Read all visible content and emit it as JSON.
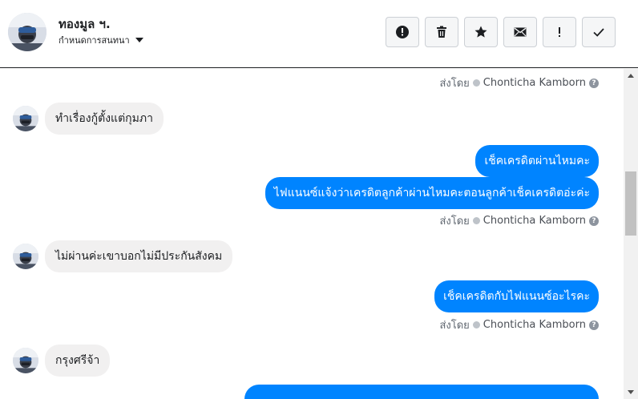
{
  "contact": {
    "name": "ทองมูล ฯ.",
    "subtitle": "กำหนดการสนทนา"
  },
  "toolbar": {
    "buttons": [
      {
        "icon": "alert-circle-icon",
        "name": "mark-spam-button"
      },
      {
        "icon": "trash-icon",
        "name": "delete-button"
      },
      {
        "icon": "star-icon",
        "name": "star-button"
      },
      {
        "icon": "envelope-icon",
        "name": "mark-unread-button"
      },
      {
        "icon": "exclamation-icon",
        "name": "follow-up-button"
      },
      {
        "icon": "check-icon",
        "name": "mark-done-button"
      }
    ]
  },
  "sentby": {
    "prefix": "ส่งโดย",
    "agent": "Chonticha Kamborn",
    "help": "?"
  },
  "messages": [
    {
      "direction": "in",
      "text": "ทำเรื่องกู้ตั้งแต่กุมภา"
    },
    {
      "direction": "out",
      "text": "เช็คเครดิตผ่านไหมคะ"
    },
    {
      "direction": "out",
      "text": "ไฟแนนซ์แจ้งว่าเครดิตลูกค้าผ่านไหมคะตอนลูกค้าเช็คเครดิตอ่ะค่ะ"
    },
    {
      "direction": "in",
      "text": "ไม่ผ่านค่ะเขาบอกไม่มีประกันสังคม"
    },
    {
      "direction": "out",
      "text": "เช็คเครดิตกับไฟแนนซ์อะไรคะ"
    },
    {
      "direction": "in",
      "text": "กรุงศรีจ้า"
    }
  ],
  "colors": {
    "outgoing_bubble": "#0084ff",
    "incoming_bubble": "#f1f0f0",
    "text_primary": "#1c1e21",
    "text_secondary": "#606770"
  }
}
